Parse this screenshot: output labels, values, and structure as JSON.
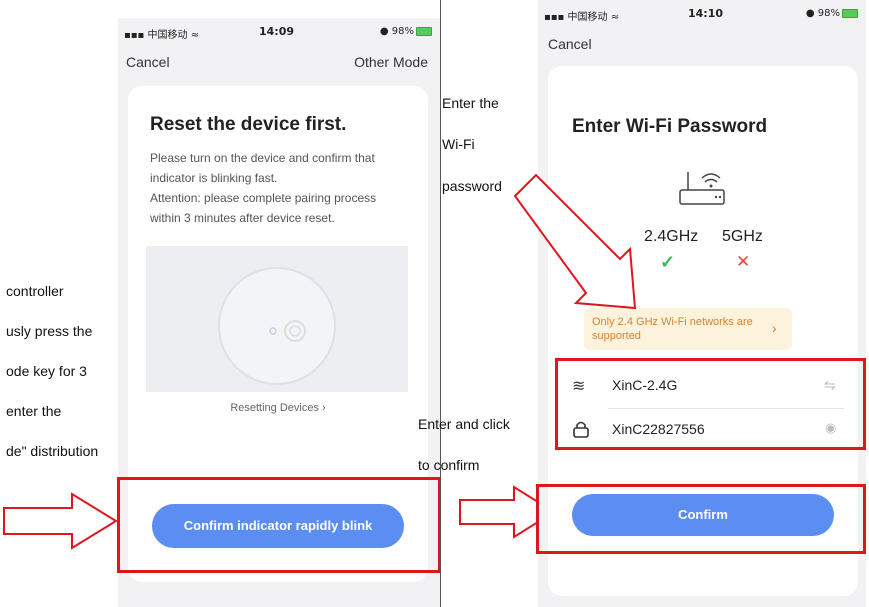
{
  "left_screen": {
    "status": {
      "carrier": "中国移动",
      "time": "14:09",
      "battery": "98%"
    },
    "nav": {
      "cancel": "Cancel",
      "other_mode": "Other Mode"
    },
    "title": "Reset the device first.",
    "instructions": [
      "Please turn on the device and confirm that",
      "indicator is blinking fast.",
      "Attention: please complete pairing process",
      "within 3 minutes after device reset."
    ],
    "resetting_link": "Resetting Devices ›",
    "confirm_button": "Confirm indicator rapidly blink"
  },
  "right_screen": {
    "status": {
      "carrier": "中国移动",
      "time": "14:10",
      "battery": "98%"
    },
    "nav": {
      "cancel": "Cancel"
    },
    "title": "Enter Wi-Fi Password",
    "band_24": "2.4GHz",
    "band_5": "5GHz",
    "warning": "Only 2.4 GHz Wi-Fi networks are supported",
    "ssid": "XinC-2.4G",
    "password": "XinC22827556",
    "confirm_button": "Confirm"
  },
  "annotations": {
    "left_lines": [
      "controller",
      "usly press the",
      "ode key for 3",
      "enter the",
      "de\" distribution"
    ],
    "enter_wifi_lines": [
      "Enter the",
      "Wi-Fi",
      "password"
    ],
    "enter_click_lines": [
      "Enter and click",
      "to confirm"
    ]
  },
  "colors": {
    "accent_blue": "#5b8ef0",
    "annotation_red": "#e0161e",
    "check_green": "#2fbf5a",
    "cross_red": "#e8473f"
  }
}
